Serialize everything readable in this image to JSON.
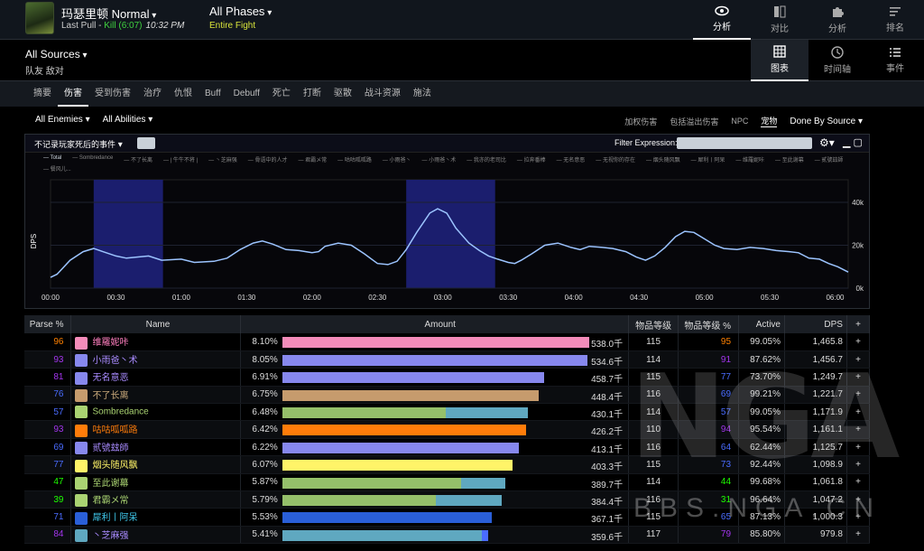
{
  "header": {
    "boss_title": "玛瑟里顿 Normal",
    "last_pull_label": "Last Pull - ",
    "kill_text": "Kill (6:07)",
    "time": "10:32 PM",
    "phase_title": "All Phases",
    "phase_sub": "Entire Fight",
    "nav": [
      {
        "label": "分析",
        "icon": "eye-icon"
      },
      {
        "label": "对比",
        "icon": "compare-icon"
      },
      {
        "label": "分析",
        "icon": "puzzle-icon"
      },
      {
        "label": "排名",
        "icon": "ranking-icon"
      }
    ]
  },
  "sources": {
    "title": "All Sources",
    "sub": "队友 敌对",
    "views": [
      {
        "label": "图表",
        "icon": "grid-icon"
      },
      {
        "label": "时间轴",
        "icon": "clock-icon"
      },
      {
        "label": "事件",
        "icon": "list-icon"
      }
    ]
  },
  "tabs": [
    "摘要",
    "伤害",
    "受到伤害",
    "治疗",
    "仇恨",
    "Buff",
    "Debuff",
    "死亡",
    "打断",
    "驱散",
    "战斗资源",
    "施法"
  ],
  "filters": {
    "enemies": "All Enemies",
    "abilities": "All Abilities",
    "options": [
      "加权伤害",
      "包括溢出伤害",
      "NPC",
      "宠物"
    ],
    "done_by": "Done By Source"
  },
  "chart_panel": {
    "death_filter": "不记录玩家死后的事件",
    "filter_expression_label": "Filter Expression:",
    "legend": [
      "Total",
      "Sombredance",
      "不了长离",
      "| 牛牛不将 |",
      "丶芝麻强",
      "骨语中的人才",
      "君霸メ常",
      "咕咕呱呱路",
      "小雨爸丶",
      "小雨爸丶术",
      "我亦的老司比",
      "拉奔番棒",
      "无名意恶",
      "无视你的存在",
      "烟头随风飘",
      "犀利丨阿呆",
      "维羅妮咔",
      "至此谢幕",
      "贰號玆師",
      "餐风儿..."
    ]
  },
  "chart_data": {
    "type": "line",
    "ylabel": "DPS",
    "x_ticks": [
      "00:00",
      "00:30",
      "01:00",
      "01:30",
      "02:00",
      "02:30",
      "03:00",
      "03:30",
      "04:00",
      "04:30",
      "05:00",
      "05:30",
      "06:00"
    ],
    "y_ticks": [
      "0k",
      "20k",
      "40k"
    ],
    "ylim": [
      0,
      40000
    ],
    "grid": true,
    "bands": [
      [
        0.33,
        0.86
      ],
      [
        2.72,
        3.4
      ]
    ],
    "series": [
      {
        "name": "Total",
        "color": "#9cc4ff",
        "points": [
          [
            0,
            5000
          ],
          [
            0.05,
            6500
          ],
          [
            0.15,
            13000
          ],
          [
            0.25,
            17000
          ],
          [
            0.33,
            18500
          ],
          [
            0.4,
            17000
          ],
          [
            0.5,
            15000
          ],
          [
            0.58,
            14000
          ],
          [
            0.66,
            14500
          ],
          [
            0.75,
            15000
          ],
          [
            0.85,
            13000
          ],
          [
            1.0,
            13500
          ],
          [
            1.1,
            12000
          ],
          [
            1.25,
            12500
          ],
          [
            1.35,
            14000
          ],
          [
            1.45,
            18000
          ],
          [
            1.55,
            21000
          ],
          [
            1.62,
            22000
          ],
          [
            1.7,
            20500
          ],
          [
            1.8,
            18000
          ],
          [
            1.9,
            17500
          ],
          [
            2.0,
            16500
          ],
          [
            2.05,
            17000
          ],
          [
            2.1,
            19500
          ],
          [
            2.2,
            21000
          ],
          [
            2.3,
            20000
          ],
          [
            2.4,
            16000
          ],
          [
            2.5,
            11500
          ],
          [
            2.58,
            11000
          ],
          [
            2.65,
            12500
          ],
          [
            2.72,
            18000
          ],
          [
            2.8,
            26000
          ],
          [
            2.9,
            35000
          ],
          [
            2.96,
            37000
          ],
          [
            3.03,
            35000
          ],
          [
            3.1,
            28000
          ],
          [
            3.2,
            21000
          ],
          [
            3.28,
            17500
          ],
          [
            3.35,
            15000
          ],
          [
            3.42,
            13500
          ],
          [
            3.5,
            12000
          ],
          [
            3.55,
            11500
          ],
          [
            3.6,
            13000
          ],
          [
            3.68,
            16000
          ],
          [
            3.78,
            20000
          ],
          [
            3.88,
            21000
          ],
          [
            3.98,
            19000
          ],
          [
            4.05,
            18000
          ],
          [
            4.12,
            19500
          ],
          [
            4.22,
            19000
          ],
          [
            4.3,
            18500
          ],
          [
            4.4,
            17000
          ],
          [
            4.48,
            14500
          ],
          [
            4.55,
            13000
          ],
          [
            4.62,
            15000
          ],
          [
            4.7,
            19000
          ],
          [
            4.78,
            24000
          ],
          [
            4.85,
            26500
          ],
          [
            4.92,
            26000
          ],
          [
            5.0,
            23000
          ],
          [
            5.08,
            20000
          ],
          [
            5.15,
            18500
          ],
          [
            5.25,
            18000
          ],
          [
            5.35,
            19000
          ],
          [
            5.45,
            18500
          ],
          [
            5.55,
            17500
          ],
          [
            5.65,
            17000
          ],
          [
            5.72,
            16500
          ],
          [
            5.8,
            14000
          ],
          [
            5.88,
            13500
          ],
          [
            5.95,
            11500
          ],
          [
            6.02,
            10000
          ],
          [
            6.1,
            7500
          ]
        ]
      }
    ]
  },
  "table": {
    "headers": [
      "Parse %",
      "Name",
      "Amount",
      "物品等级",
      "物品等级 %",
      "Active",
      "DPS",
      "+"
    ],
    "rows": [
      {
        "parse": "96",
        "parse_color": "#ff8000",
        "name": "维羅妮咔",
        "name_color": "#ff7fbf",
        "icon_color": "#f48cba",
        "pct": "8.10%",
        "bars": [
          {
            "w": 100,
            "c": "#f48cba"
          }
        ],
        "amount": "538.0千",
        "ilvl": "115",
        "ilvl_pct": "95",
        "ilvl_pct_color": "#ff8000",
        "active": "99.05%",
        "dps": "1,465.8"
      },
      {
        "parse": "93",
        "parse_color": "#a335ee",
        "name": "小雨爸丶术",
        "name_color": "#a98bff",
        "icon_color": "#8788ee",
        "pct": "8.05%",
        "bars": [
          {
            "w": 99.4,
            "c": "#8788ee"
          }
        ],
        "amount": "534.6千",
        "ilvl": "114",
        "ilvl_pct": "91",
        "ilvl_pct_color": "#a335ee",
        "active": "87.62%",
        "dps": "1,456.7"
      },
      {
        "parse": "81",
        "parse_color": "#a335ee",
        "name": "无名意恶",
        "name_color": "#a98bff",
        "icon_color": "#8788ee",
        "pct": "6.91%",
        "bars": [
          {
            "w": 85.3,
            "c": "#8788ee"
          }
        ],
        "amount": "458.7千",
        "ilvl": "115",
        "ilvl_pct": "77",
        "ilvl_pct_color": "#4a6cff",
        "active": "73.70%",
        "dps": "1,249.7"
      },
      {
        "parse": "76",
        "parse_color": "#4a6cff",
        "name": "不了长离",
        "name_color": "#c8a87a",
        "icon_color": "#c69b6d",
        "pct": "6.75%",
        "bars": [
          {
            "w": 83.4,
            "c": "#c69b6d"
          }
        ],
        "amount": "448.4千",
        "ilvl": "116",
        "ilvl_pct": "69",
        "ilvl_pct_color": "#4a6cff",
        "active": "99.21%",
        "dps": "1,221.7"
      },
      {
        "parse": "57",
        "parse_color": "#4a6cff",
        "name": "Sombredance",
        "name_color": "#aad372",
        "icon_color": "#aad372",
        "pct": "6.48%",
        "bars": [
          {
            "w": 53,
            "c": "#95c06a"
          },
          {
            "w": 27,
            "c": "#5fa8c0"
          }
        ],
        "amount": "430.1千",
        "ilvl": "114",
        "ilvl_pct": "57",
        "ilvl_pct_color": "#4a6cff",
        "active": "99.05%",
        "dps": "1,171.9"
      },
      {
        "parse": "93",
        "parse_color": "#a335ee",
        "name": "咕咕呱呱路",
        "name_color": "#ff7c0a",
        "icon_color": "#ff7c0a",
        "pct": "6.42%",
        "bars": [
          {
            "w": 79.3,
            "c": "#ff7c0a"
          }
        ],
        "amount": "426.2千",
        "ilvl": "110",
        "ilvl_pct": "94",
        "ilvl_pct_color": "#a335ee",
        "active": "95.54%",
        "dps": "1,161.1"
      },
      {
        "parse": "69",
        "parse_color": "#4a6cff",
        "name": "贰號玆師",
        "name_color": "#a98bff",
        "icon_color": "#8788ee",
        "pct": "6.22%",
        "bars": [
          {
            "w": 76.8,
            "c": "#8788ee"
          }
        ],
        "amount": "413.1千",
        "ilvl": "116",
        "ilvl_pct": "64",
        "ilvl_pct_color": "#4a6cff",
        "active": "62.44%",
        "dps": "1,125.7"
      },
      {
        "parse": "77",
        "parse_color": "#4a6cff",
        "name": "烟头随风飘",
        "name_color": "#fff468",
        "icon_color": "#fff468",
        "pct": "6.07%",
        "bars": [
          {
            "w": 75,
            "c": "#fff468"
          }
        ],
        "amount": "403.3千",
        "ilvl": "115",
        "ilvl_pct": "73",
        "ilvl_pct_color": "#4a6cff",
        "active": "92.44%",
        "dps": "1,098.9"
      },
      {
        "parse": "47",
        "parse_color": "#1eff00",
        "name": "至此谢幕",
        "name_color": "#aad372",
        "icon_color": "#aad372",
        "pct": "5.87%",
        "bars": [
          {
            "w": 58,
            "c": "#95c06a"
          },
          {
            "w": 14.5,
            "c": "#5fa8c0"
          }
        ],
        "amount": "389.7千",
        "ilvl": "114",
        "ilvl_pct": "44",
        "ilvl_pct_color": "#1eff00",
        "active": "99.68%",
        "dps": "1,061.8"
      },
      {
        "parse": "39",
        "parse_color": "#1eff00",
        "name": "君霸メ常",
        "name_color": "#aad372",
        "icon_color": "#aad372",
        "pct": "5.79%",
        "bars": [
          {
            "w": 50,
            "c": "#95c06a"
          },
          {
            "w": 21.5,
            "c": "#5fa8c0"
          }
        ],
        "amount": "384.4千",
        "ilvl": "116",
        "ilvl_pct": "31",
        "ilvl_pct_color": "#1eff00",
        "active": "96.64%",
        "dps": "1,047.2"
      },
      {
        "parse": "71",
        "parse_color": "#4a6cff",
        "name": "犀利丨阿呆",
        "name_color": "#3fc7eb",
        "icon_color": "#2a5fd8",
        "pct": "5.53%",
        "bars": [
          {
            "w": 68.2,
            "c": "#2a5fd8"
          }
        ],
        "amount": "367.1千",
        "ilvl": "115",
        "ilvl_pct": "65",
        "ilvl_pct_color": "#4a6cff",
        "active": "87.13%",
        "dps": "1,000.3"
      },
      {
        "parse": "84",
        "parse_color": "#a335ee",
        "name": "丶芝麻强",
        "name_color": "#a98bff",
        "icon_color": "#5fa8c0",
        "pct": "5.41%",
        "bars": [
          {
            "w": 65,
            "c": "#5fa8c0"
          },
          {
            "w": 2,
            "c": "#4a6cff"
          }
        ],
        "amount": "359.6千",
        "ilvl": "117",
        "ilvl_pct": "79",
        "ilvl_pct_color": "#a335ee",
        "active": "85.80%",
        "dps": "979.8"
      }
    ]
  },
  "watermark": {
    "logo": "NGA",
    "text": "BBS.NGA.CN"
  }
}
